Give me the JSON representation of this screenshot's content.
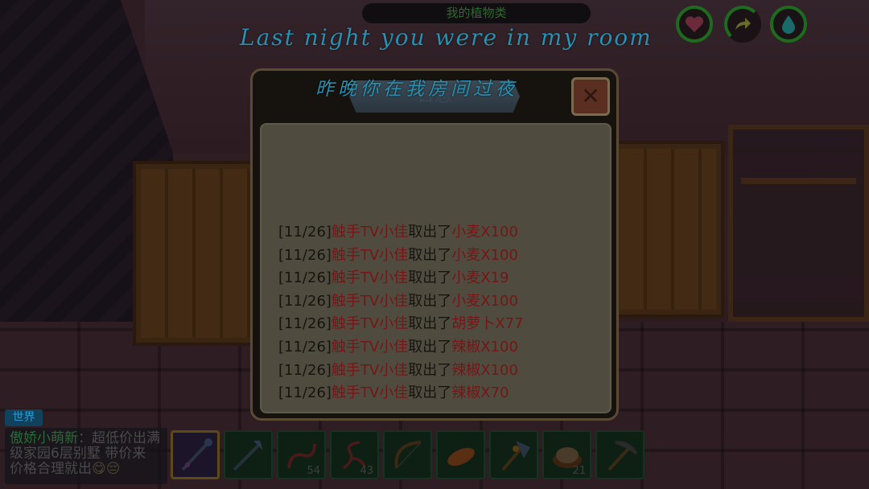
{
  "hud": {
    "plant_label": "我的植物类",
    "icons": [
      "heart-icon",
      "arrow-icon",
      "water-drop-icon"
    ]
  },
  "lyrics": {
    "english": "Last night you were in my room",
    "chinese": "昨晚你在我房间过夜"
  },
  "log_dialog": {
    "title": "日志",
    "close_label": "✕",
    "entries": [
      {
        "date": "[11/26]",
        "actor": "触手TV小佳",
        "verb": "取出了",
        "item": "小麦X100"
      },
      {
        "date": "[11/26]",
        "actor": "触手TV小佳",
        "verb": "取出了",
        "item": "小麦X100"
      },
      {
        "date": "[11/26]",
        "actor": "触手TV小佳",
        "verb": "取出了",
        "item": "小麦X19"
      },
      {
        "date": "[11/26]",
        "actor": "触手TV小佳",
        "verb": "取出了",
        "item": "小麦X100"
      },
      {
        "date": "[11/26]",
        "actor": "触手TV小佳",
        "verb": "取出了",
        "item": "胡萝卜X77"
      },
      {
        "date": "[11/26]",
        "actor": "触手TV小佳",
        "verb": "取出了",
        "item": "辣椒X100"
      },
      {
        "date": "[11/26]",
        "actor": "触手TV小佳",
        "verb": "取出了",
        "item": "辣椒X100"
      },
      {
        "date": "[11/26]",
        "actor": "触手TV小佳",
        "verb": "取出了",
        "item": "辣椒X70"
      }
    ]
  },
  "chat": {
    "channel": "世界",
    "user": "傲娇小萌新",
    "separator": "：",
    "message": "超低价出满级家园6层别墅 带价来  价格合理就出",
    "emoji": "😋😔"
  },
  "hotbar": {
    "slots": [
      {
        "icon": "staff-icon",
        "count": "",
        "selected": true
      },
      {
        "icon": "trident-icon",
        "count": ""
      },
      {
        "icon": "whip-icon",
        "count": "54"
      },
      {
        "icon": "vine-icon",
        "count": "43"
      },
      {
        "icon": "bow-icon",
        "count": ""
      },
      {
        "icon": "bread-icon",
        "count": ""
      },
      {
        "icon": "battle-axe-icon",
        "count": ""
      },
      {
        "icon": "dumpling-icon",
        "count": "21"
      },
      {
        "icon": "pickaxe-icon",
        "count": ""
      }
    ]
  }
}
